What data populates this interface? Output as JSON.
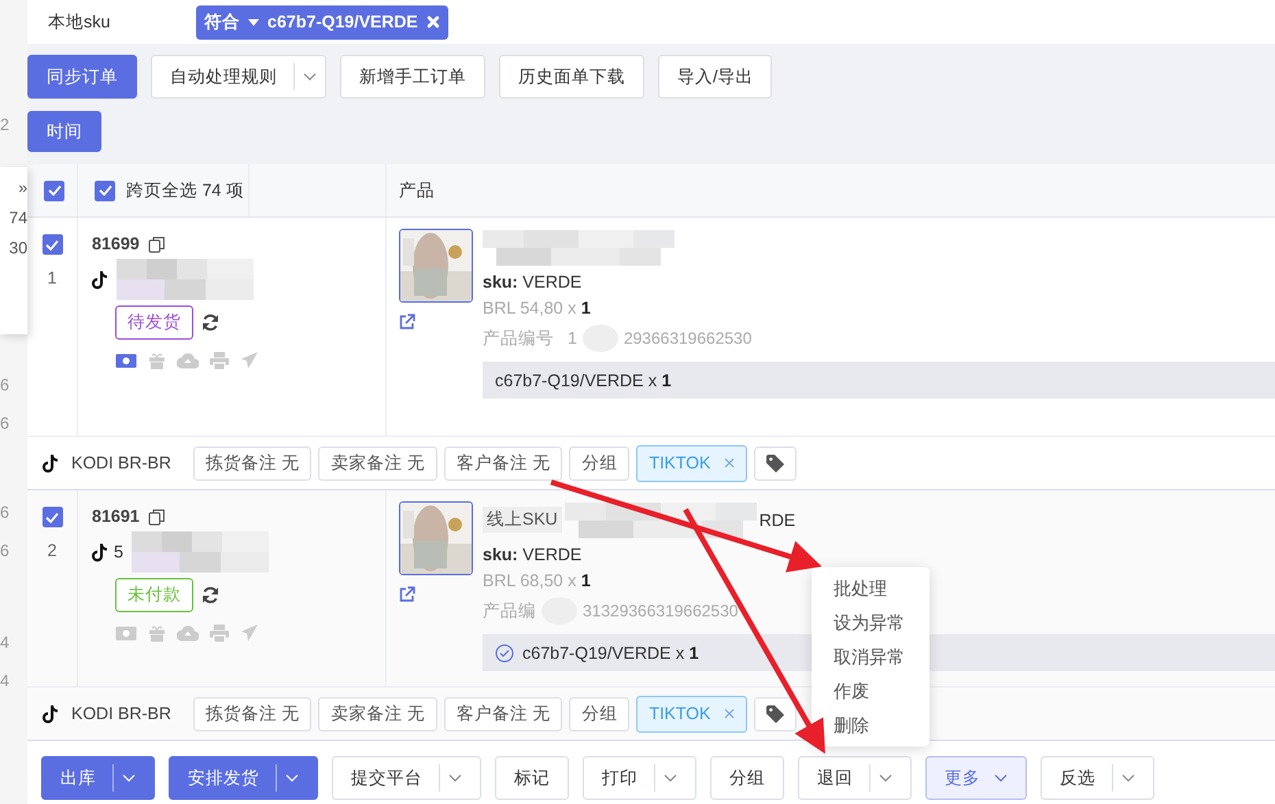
{
  "side_panel": {
    "collapse": "»",
    "counts": [
      "74",
      "30"
    ]
  },
  "side_fragments": [
    "2",
    "6",
    "6",
    "6",
    "6",
    "4",
    "4"
  ],
  "filter": {
    "label": "本地sku",
    "operator": "符合",
    "value": "c67b7-Q19/VERDE"
  },
  "toolbar": [
    {
      "label": "同步订单",
      "kind": "primary"
    },
    {
      "label": "自动处理规则",
      "kind": "split"
    },
    {
      "label": "新增手工订单",
      "kind": "plain"
    },
    {
      "label": "历史面单下载",
      "kind": "plain"
    },
    {
      "label": "导入/导出",
      "kind": "plain"
    }
  ],
  "time_button": "时间",
  "table": {
    "select_all_checked": true,
    "cross_page": {
      "label": "跨页全选 74 项",
      "checked": true
    },
    "columns": [
      "产品"
    ]
  },
  "orders": [
    {
      "index": "1",
      "checked": true,
      "order_no": "81699",
      "status": "待发货",
      "color": "#9d4edd",
      "product": {
        "sku_label": "sku:",
        "sku": "VERDE",
        "price": "BRL 54,80 x",
        "qty": "1",
        "number_label": "产品编号",
        "number_prefix": "1",
        "number": "29366319662530",
        "mapping": "c67b7-Q19/VERDE x",
        "mapping_qty": "1",
        "matched": false
      },
      "store": "KODI BR-BR",
      "notes": [
        "拣货备注 无",
        "卖家备注 无",
        "客户备注 无"
      ],
      "group": "分组",
      "tag": "TIKTOK"
    },
    {
      "index": "2",
      "checked": true,
      "order_no": "81691",
      "buyer_prefix": "5",
      "status": "未付款",
      "color": "#67c23a",
      "product": {
        "title_prefix": "线上SKU",
        "title_suffix": "RDE",
        "sku_label": "sku:",
        "sku": "VERDE",
        "price": "BRL 68,50 x",
        "qty": "1",
        "number_label": "产品编",
        "number": "31329366319662530",
        "mapping": "c67b7-Q19/VERDE x",
        "mapping_qty": "1",
        "matched": true
      },
      "store": "KODI BR-BR",
      "notes": [
        "拣货备注 无",
        "卖家备注 无",
        "客户备注 无"
      ],
      "group": "分组",
      "tag": "TIKTOK"
    }
  ],
  "actions": [
    {
      "label": "出库",
      "kind": "primary",
      "split": true,
      "selected": false
    },
    {
      "label": "安排发货",
      "kind": "primary",
      "split": true,
      "selected": false
    },
    {
      "label": "提交平台",
      "kind": "plain",
      "split": true,
      "selected": false
    },
    {
      "label": "标记",
      "kind": "plain",
      "split": false,
      "selected": false
    },
    {
      "label": "打印",
      "kind": "plain",
      "split": true,
      "selected": false
    },
    {
      "label": "分组",
      "kind": "plain",
      "split": false,
      "selected": false
    },
    {
      "label": "退回",
      "kind": "plain",
      "split": true,
      "selected": false
    },
    {
      "label": "更多",
      "kind": "menu",
      "split": false,
      "selected": true
    },
    {
      "label": "反选",
      "kind": "plain",
      "split": true,
      "selected": false
    }
  ],
  "more_menu": [
    "批处理",
    "设为异常",
    "取消异常",
    "作废",
    "删除"
  ]
}
